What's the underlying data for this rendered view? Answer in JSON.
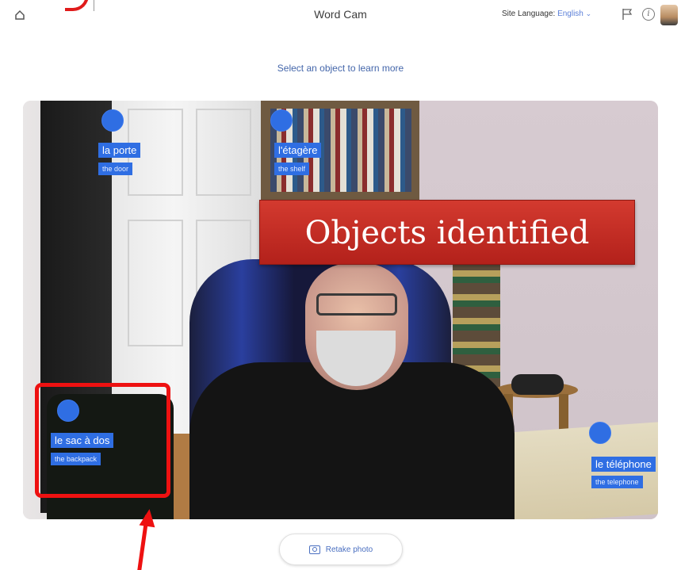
{
  "header": {
    "title": "Word Cam",
    "site_language_label": "Site Language:",
    "site_language_value": "English",
    "icons": {
      "home": "home-icon",
      "flag": "flag-icon",
      "info": "info-icon",
      "avatar": "avatar"
    }
  },
  "instruction": "Select an object to learn more",
  "objects": [
    {
      "target": "la porte",
      "translation": "the door"
    },
    {
      "target": "l'étagère",
      "translation": "the shelf"
    },
    {
      "target": "le sac à dos",
      "translation": "the backpack"
    },
    {
      "target": "le téléphone",
      "translation": "the telephone"
    }
  ],
  "annotation": {
    "banner_text": "Objects identified"
  },
  "footer": {
    "retake_label": "Retake photo",
    "retake_icon": "camera-icon"
  },
  "colors": {
    "accent": "#2f6ee3",
    "banner": "#c42b23",
    "annotation_red": "#ee1111"
  }
}
